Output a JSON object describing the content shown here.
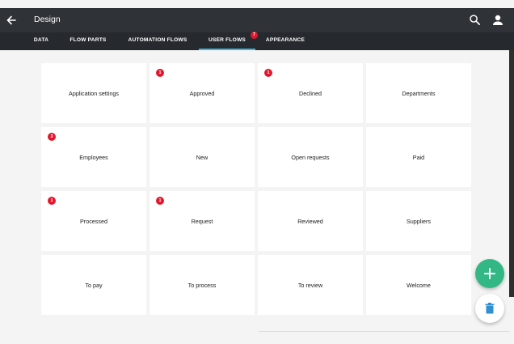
{
  "header": {
    "title": "Design",
    "back_icon": "arrow-left-icon",
    "search_icon": "search-icon",
    "account_icon": "person-icon"
  },
  "tabs": [
    {
      "label": "DATA"
    },
    {
      "label": "FLOW PARTS"
    },
    {
      "label": "AUTOMATION FLOWS"
    },
    {
      "label": "USER FLOWS",
      "badge": "7",
      "active": true
    },
    {
      "label": "APPEARANCE"
    }
  ],
  "cards": [
    {
      "label": "Application settings"
    },
    {
      "label": "Approved",
      "badge": "1"
    },
    {
      "label": "Declined",
      "badge": "1"
    },
    {
      "label": "Departments"
    },
    {
      "label": "Employees",
      "badge": "3"
    },
    {
      "label": "New"
    },
    {
      "label": "Open requests"
    },
    {
      "label": "Paid"
    },
    {
      "label": "Processed",
      "badge": "1"
    },
    {
      "label": "Request",
      "badge": "1"
    },
    {
      "label": "Reviewed"
    },
    {
      "label": "Suppliers"
    },
    {
      "label": "To pay"
    },
    {
      "label": "To process"
    },
    {
      "label": "To review"
    },
    {
      "label": "Welcome"
    }
  ],
  "actions": {
    "add_icon": "plus-icon",
    "delete_icon": "trash-icon"
  },
  "colors": {
    "header_bg": "#2f3237",
    "tab_bar_bg": "#26292d",
    "active_tab_underline": "#3fb7dd",
    "badge": "#e2172d",
    "fab_add": "#33b885",
    "delete_icon": "#2f8fd0"
  }
}
